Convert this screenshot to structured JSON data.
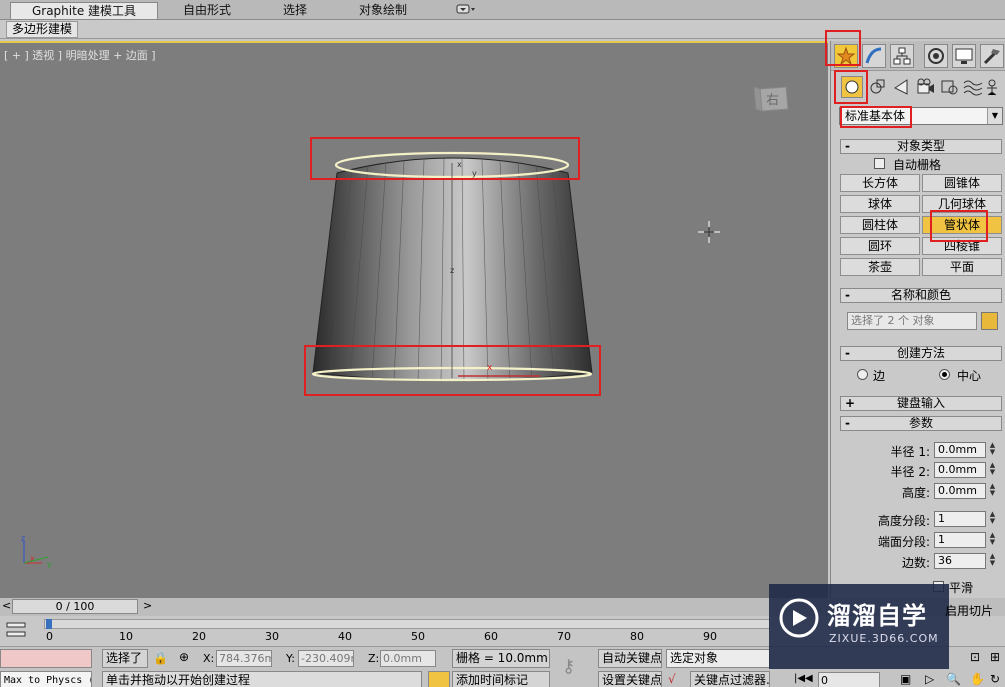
{
  "ribbon": {
    "tabs": [
      "Graphite 建模工具",
      "自由形式",
      "选择",
      "对象绘制"
    ],
    "subtab": "多边形建模"
  },
  "viewport": {
    "label": "[ + ] 透视 ] 明暗处理 + 边面 ]",
    "viewcube_face": "右",
    "gizmo_labels": [
      "x",
      "y",
      "z"
    ]
  },
  "command_panel": {
    "category": "标准基本体",
    "rollouts": {
      "object_type": "对象类型",
      "name_color": "名称和颜色",
      "creation_method": "创建方法",
      "keyboard_entry": "键盘输入",
      "parameters": "参数"
    },
    "auto_grid": "自动栅格",
    "object_buttons": [
      "长方体",
      "圆锥体",
      "球体",
      "几何球体",
      "圆柱体",
      "管状体",
      "圆环",
      "四棱锥",
      "茶壶",
      "平面"
    ],
    "active_button": "管状体",
    "name_placeholder": "选择了 2 个 对象",
    "creation": {
      "edge": "边",
      "center": "中心",
      "selected": "中心"
    },
    "params": [
      {
        "label": "半径 1:",
        "value": "0.0mm"
      },
      {
        "label": "半径 2:",
        "value": "0.0mm"
      },
      {
        "label": "高度:",
        "value": "0.0mm"
      },
      {
        "label": "高度分段:",
        "value": "1"
      },
      {
        "label": "端面分段:",
        "value": "1"
      },
      {
        "label": "边数:",
        "value": "36"
      }
    ],
    "smooth": "平滑",
    "slice": "启用切片",
    "colors": {
      "accent": "#f0c442",
      "highlight": "#e02020"
    }
  },
  "timeline": {
    "frame": "0 / 100",
    "ticks": [
      "0",
      "10",
      "20",
      "30",
      "40",
      "50",
      "60",
      "70",
      "80",
      "90"
    ]
  },
  "status": {
    "left_text": "Max to Physcs (",
    "selection": "选择了",
    "x_label": "X:",
    "x_value": "784.376mm",
    "y_label": "Y:",
    "y_value": "-230.409m",
    "z_label": "Z:",
    "z_value": "0.0mm",
    "grid": "栅格 = 10.0mm",
    "auto_key": "自动关键点",
    "selected_object": "选定对象",
    "set_key": "设置关键点",
    "key_filters": "关键点过滤器...",
    "frame_value": "0",
    "prompt": "单击并拖动以开始创建过程",
    "add_time_tag": "添加时间标记"
  },
  "watermark": {
    "title": "溜溜自学",
    "url": "ZIXUE.3D66.COM"
  }
}
